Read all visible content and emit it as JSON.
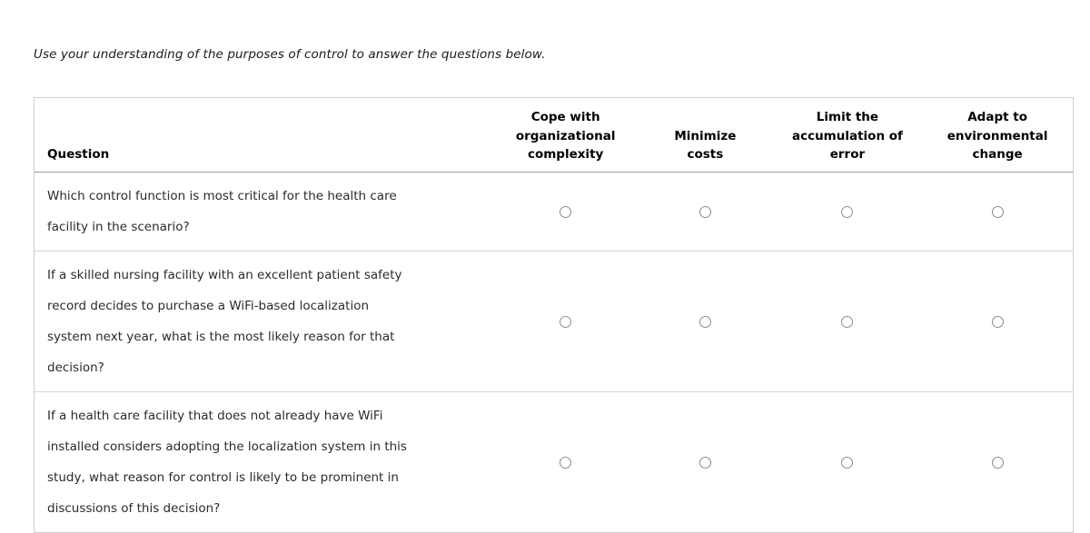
{
  "intro": {
    "text": "Use your understanding of the purposes of control to answer the questions below."
  },
  "table": {
    "headers": {
      "question": "Question",
      "options": [
        {
          "id": "cope-with-organizational-complexity",
          "lines": [
            "Cope with",
            "organizational",
            "complexity"
          ]
        },
        {
          "id": "minimize-costs",
          "lines": [
            "Minimize",
            "costs"
          ]
        },
        {
          "id": "limit-the-accumulation-of-error",
          "lines": [
            "Limit the",
            "accumulation of",
            "error"
          ]
        },
        {
          "id": "adapt-to-environmental-change",
          "lines": [
            "Adapt to",
            "environmental",
            "change"
          ]
        }
      ]
    },
    "rows": [
      {
        "id": "question-1",
        "lines": [
          "Which control function is most critical for the health care",
          "facility in the scenario?"
        ],
        "selected": null
      },
      {
        "id": "question-2",
        "lines": [
          "If a skilled nursing facility with an excellent patient safety",
          "record decides to purchase a WiFi-based localization",
          "system next year, what is the most likely reason for that",
          "decision?"
        ],
        "selected": null
      },
      {
        "id": "question-3",
        "lines": [
          "If a health care facility that does not already have WiFi",
          "installed considers adopting the localization system in this",
          "study, what reason for control is likely to be prominent in",
          "discussions of this decision?"
        ],
        "selected": null
      }
    ]
  },
  "colors": {
    "page_background": "#ffffff",
    "table_border": "#cfcfcf",
    "header_rule": "#9a9a9a",
    "row_rule": "#d8d8d8",
    "text": "#1a1a1a",
    "body_text": "#2b2b2b",
    "radio_border": "#8c8c8c"
  }
}
